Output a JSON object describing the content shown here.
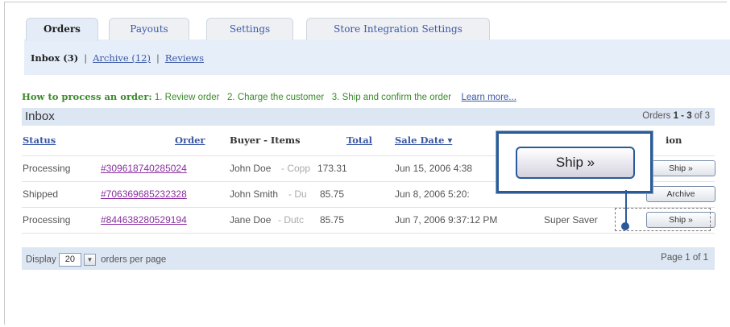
{
  "tabs": [
    {
      "label": "Orders",
      "active": true
    },
    {
      "label": "Payouts",
      "active": false
    },
    {
      "label": "Settings",
      "active": false
    },
    {
      "label": "Store Integration Settings",
      "active": false
    }
  ],
  "subnav": {
    "inbox": "Inbox (3)",
    "archive": "Archive (12)",
    "reviews": "Reviews",
    "separator": "|"
  },
  "howto": {
    "title": "How to process an order:",
    "step1": "1. Review order",
    "step2": "2. Charge the customer",
    "step3": "3. Ship and confirm the order",
    "learn_more": "Learn more..."
  },
  "inbox": {
    "title": "Inbox",
    "count_prefix": "Orders ",
    "count_range": "1 - 3",
    "count_suffix": " of 3"
  },
  "columns": {
    "status": "Status",
    "order": "Order",
    "buyer_items": "Buyer - Items",
    "total": "Total",
    "sale_date": "Sale Date ▾",
    "action": "ion"
  },
  "rows": [
    {
      "status": "Processing",
      "order": "#309618740285024",
      "buyer": "John Doe",
      "items": "- Copp",
      "total": "173.31",
      "date": "Jun 15, 2006 4:38",
      "shipping": "",
      "action": "Ship »"
    },
    {
      "status": "Shipped",
      "order": "#706369685232328",
      "buyer": "John Smith",
      "items": "- Du",
      "total": "85.75",
      "date": "Jun 8, 2006 5:20:",
      "shipping": "",
      "action": "Archive"
    },
    {
      "status": "Processing",
      "order": "#844638280529194",
      "buyer": "Jane Doe",
      "items": "- Dutc",
      "total": "85.75",
      "date": "Jun 7, 2006 9:37:12 PM",
      "shipping": "Super Saver",
      "action": "Ship »"
    }
  ],
  "footer": {
    "display_label": "Display",
    "per_page_value": "20",
    "per_page_suffix": "orders per page",
    "page_info": "Page 1 of 1"
  },
  "callout": {
    "button_label": "Ship »"
  },
  "icons": {
    "dropdown": "chevron-down-icon"
  },
  "colors": {
    "link": "#3a58a6",
    "visited_link": "#8a2fa0",
    "howto_green": "#3b8a2b",
    "header_bg": "#dde6f3",
    "callout_border": "#2a5b98"
  }
}
